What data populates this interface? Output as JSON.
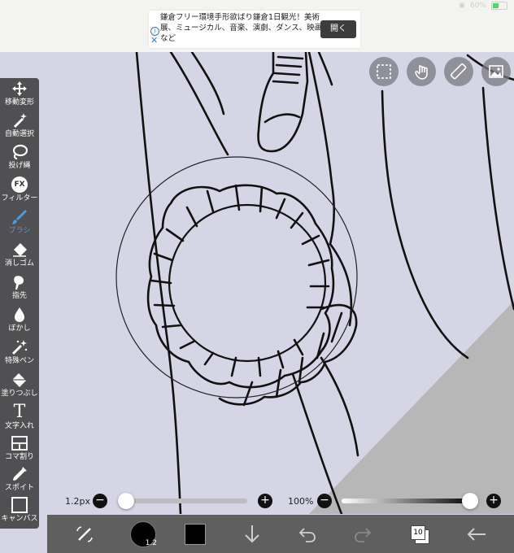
{
  "status": {
    "battery": "60%"
  },
  "ad": {
    "text": "鎌倉フリー環境手形欲ばり鎌倉1日観光！美術展、ミュージカル、音楽、演劇、ダンス、映画など",
    "button": "開く",
    "info_icon": "info-icon",
    "close_icon": "close-icon"
  },
  "toolbar": {
    "items": [
      {
        "label": "移動変形",
        "icon": "move-transform-icon"
      },
      {
        "label": "自動選択",
        "icon": "magic-wand-icon"
      },
      {
        "label": "投げ縄",
        "icon": "lasso-icon"
      },
      {
        "label": "フィルター",
        "icon": "fx-icon",
        "glyph": "FX"
      },
      {
        "label": "ブラシ",
        "icon": "brush-icon",
        "active": true
      },
      {
        "label": "消しゴム",
        "icon": "eraser-icon"
      },
      {
        "label": "指先",
        "icon": "smudge-icon"
      },
      {
        "label": "ぼかし",
        "icon": "blur-drop-icon"
      },
      {
        "label": "特殊ペン",
        "icon": "special-pen-icon"
      },
      {
        "label": "塗りつぶし",
        "icon": "fill-bucket-icon"
      },
      {
        "label": "文字入れ",
        "icon": "text-icon",
        "glyph": "T"
      },
      {
        "label": "コマ割り",
        "icon": "frame-divider-icon"
      },
      {
        "label": "スポイト",
        "icon": "eyedropper-icon"
      },
      {
        "label": "キャンバス",
        "icon": "canvas-icon"
      }
    ],
    "active_color": "#4a9ee0"
  },
  "top_right": [
    {
      "icon": "selection-icon"
    },
    {
      "icon": "touch-hand-icon"
    },
    {
      "icon": "ruler-icon"
    },
    {
      "icon": "image-icon"
    }
  ],
  "sliders": {
    "brush_size": {
      "label": "1.2px",
      "minus": "−",
      "plus": "+",
      "level": 0.05
    },
    "opacity": {
      "label": "100%",
      "minus": "−",
      "plus": "+",
      "level": 1.0
    }
  },
  "bottombar": {
    "brush_size_badge": "1.2",
    "layer_count": "10",
    "icons": [
      "adjust-icon",
      "brush-size-icon",
      "color-icon",
      "download-icon",
      "undo-icon",
      "redo-icon",
      "layers-icon",
      "back-icon"
    ]
  }
}
